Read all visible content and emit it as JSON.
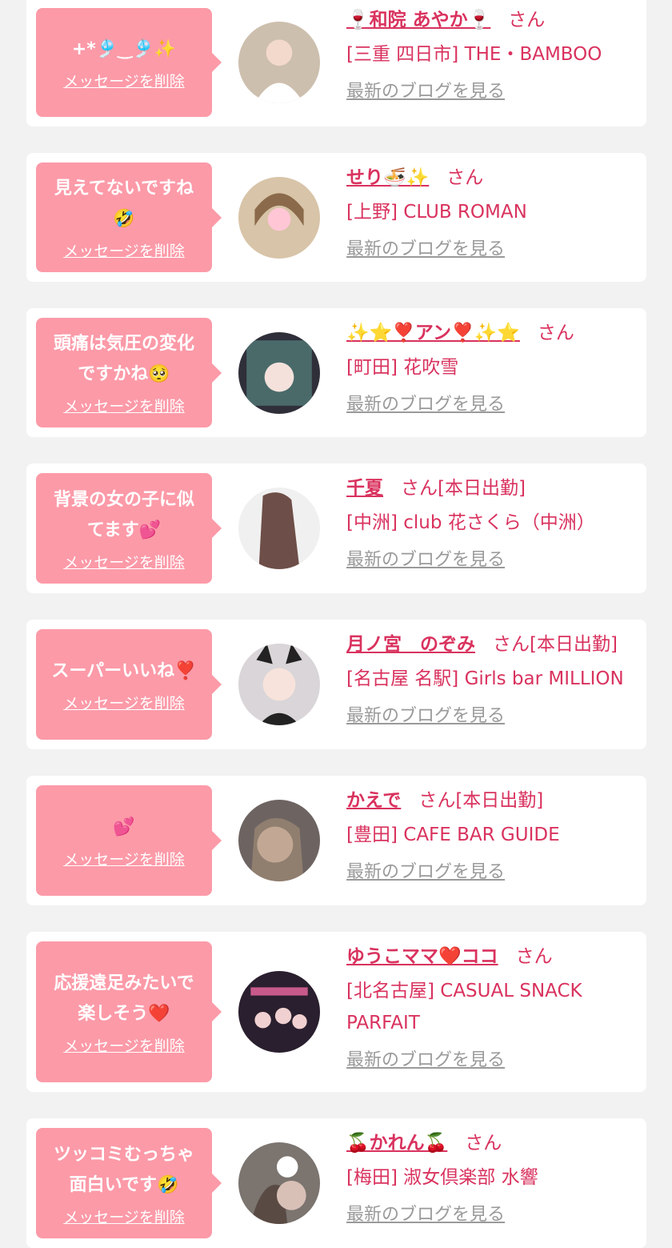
{
  "common": {
    "delete_label": "メッセージを削除",
    "blog_label": "最新のブログを見る"
  },
  "colors": {
    "page_bg": "#f2f2f2",
    "card_bg": "#ffffff",
    "bubble": "#fc9aa8",
    "accent": "#d9325e",
    "muted": "#9a9a9a"
  },
  "messages": [
    {
      "message": "+*🎐‿🎐✨",
      "name": "🍷和院 あやか🍷",
      "suffix": "さん",
      "shop": "[三重 四日市] THE・BAMBOO",
      "avatar_icon": "avatar-photo-icon"
    },
    {
      "message": "見えてないですね\n🤣",
      "name": "せり🍜✨",
      "suffix": "さん",
      "shop": "[上野] CLUB ROMAN",
      "avatar_icon": "avatar-photo-icon"
    },
    {
      "message": "頭痛は気圧の変化\nですかね🥺",
      "name": "✨⭐❣️アン❣️✨⭐",
      "suffix": "さん",
      "shop": "[町田] 花吹雪",
      "avatar_icon": "avatar-photo-icon"
    },
    {
      "message": "背景の女の子に似\nてます💕",
      "name": "千夏",
      "suffix": "さん[本日出勤]",
      "shop": "[中洲] club 花さくら（中洲）",
      "avatar_icon": "avatar-photo-icon"
    },
    {
      "message": "スーパーいいね❣️",
      "name": "月ノ宮　のぞみ",
      "suffix": "さん[本日出勤]",
      "shop": "[名古屋 名駅] Girls bar MILLION",
      "avatar_icon": "avatar-photo-icon"
    },
    {
      "message": "💕",
      "name": "かえで",
      "suffix": "さん[本日出勤]",
      "shop": "[豊田] CAFE BAR GUIDE",
      "avatar_icon": "avatar-photo-icon"
    },
    {
      "message": "応援遠足みたいで\n楽しそう❤️",
      "name": "ゆうこママ❤️ココ",
      "suffix": "さん",
      "shop": "[北名古屋] CASUAL SNACK PARFAIT",
      "avatar_icon": "avatar-photo-icon"
    },
    {
      "message": "ツッコミむっちゃ\n面白いです🤣",
      "name": "🍒かれん🍒",
      "suffix": "さん",
      "shop": "[梅田] 淑女倶楽部 水響",
      "avatar_icon": "avatar-photo-icon"
    }
  ]
}
